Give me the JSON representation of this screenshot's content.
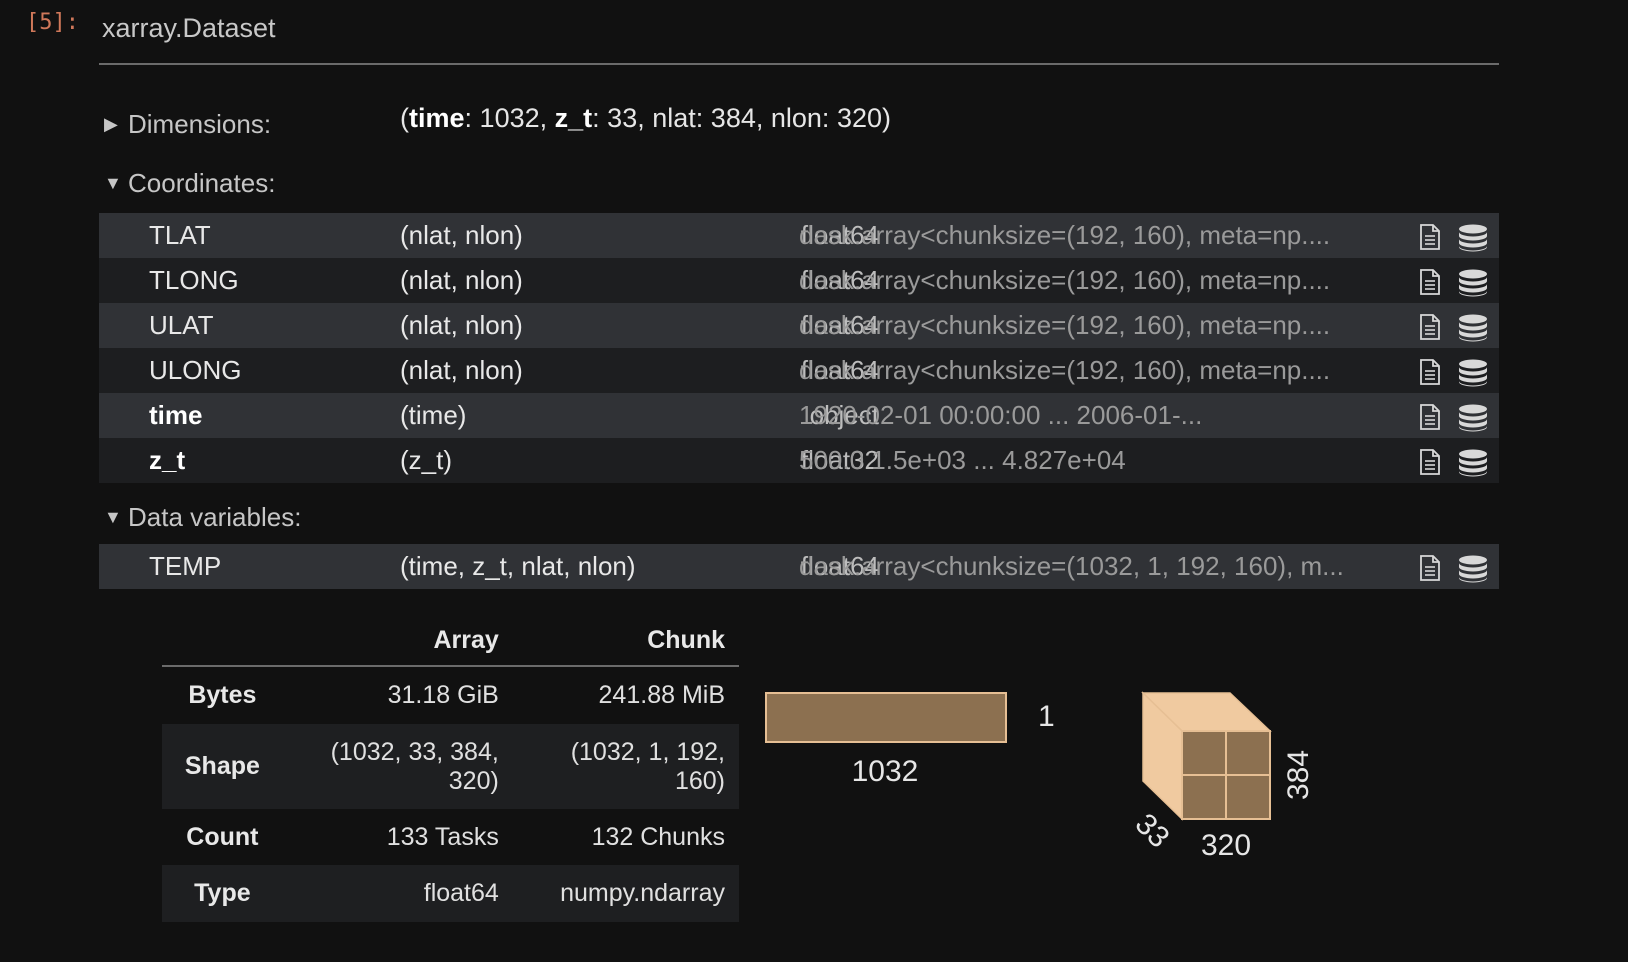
{
  "cell": {
    "prompt": "[5]:",
    "title": "xarray.Dataset"
  },
  "sections": {
    "dimensions_label": "Dimensions:",
    "coordinates_label": "Coordinates:",
    "data_variables_label": "Data variables:"
  },
  "dimensions": [
    {
      "name": "time",
      "size": "1032",
      "bold": true
    },
    {
      "name": "z_t",
      "size": "33",
      "bold": true
    },
    {
      "name": "nlat",
      "size": "384",
      "bold": false
    },
    {
      "name": "nlon",
      "size": "320",
      "bold": false
    }
  ],
  "coordinates": [
    {
      "name": "TLAT",
      "dims": "(nlat, nlon)",
      "dtype": "float64",
      "preview": "dask.array<chunksize=(192, 160), meta=np....",
      "bold": false
    },
    {
      "name": "TLONG",
      "dims": "(nlat, nlon)",
      "dtype": "float64",
      "preview": "dask.array<chunksize=(192, 160), meta=np....",
      "bold": false
    },
    {
      "name": "ULAT",
      "dims": "(nlat, nlon)",
      "dtype": "float64",
      "preview": "dask.array<chunksize=(192, 160), meta=np....",
      "bold": false
    },
    {
      "name": "ULONG",
      "dims": "(nlat, nlon)",
      "dtype": "float64",
      "preview": "dask.array<chunksize=(192, 160), meta=np....",
      "bold": false
    },
    {
      "name": "time",
      "dims": "(time)",
      "dtype": "object",
      "preview": "1920-02-01 00:00:00 ... 2006-01-...",
      "bold": true
    },
    {
      "name": "z_t",
      "dims": "(z_t)",
      "dtype": "float32",
      "preview": "500.0 1.5e+03 ... 4.827e+04",
      "bold": true
    }
  ],
  "data_variables": [
    {
      "name": "TEMP",
      "dims": "(time, z_t, nlat, nlon)",
      "dtype": "float64",
      "preview": "dask.array<chunksize=(1032, 1, 192, 160), m...",
      "bold": false
    }
  ],
  "chunk_table": {
    "col_array": "Array",
    "col_chunk": "Chunk",
    "bytes": {
      "label": "Bytes",
      "array": "31.18 GiB",
      "chunk": "241.88 MiB"
    },
    "shape": {
      "label": "Shape",
      "array_l1": "(1032, 33, 384,",
      "array_l2": "320)",
      "chunk_l1": "(1032, 1, 192,",
      "chunk_l2": "160)"
    },
    "count": {
      "label": "Count",
      "array": "133 Tasks",
      "chunk": "132 Chunks"
    },
    "type": {
      "label": "Type",
      "array": "float64",
      "chunk": "numpy.ndarray"
    }
  },
  "diagram": {
    "bar_width_label": "1032",
    "bar_height_label": "1",
    "cube_depth_label": "33",
    "cube_width_label": "320",
    "cube_height_label": "384",
    "bar_fill": "#8c7050",
    "cube_light": "#f0caa0",
    "cube_face": "#8c7050"
  },
  "icons": {
    "attrs": "file-doc-icon",
    "data": "database-icon"
  }
}
